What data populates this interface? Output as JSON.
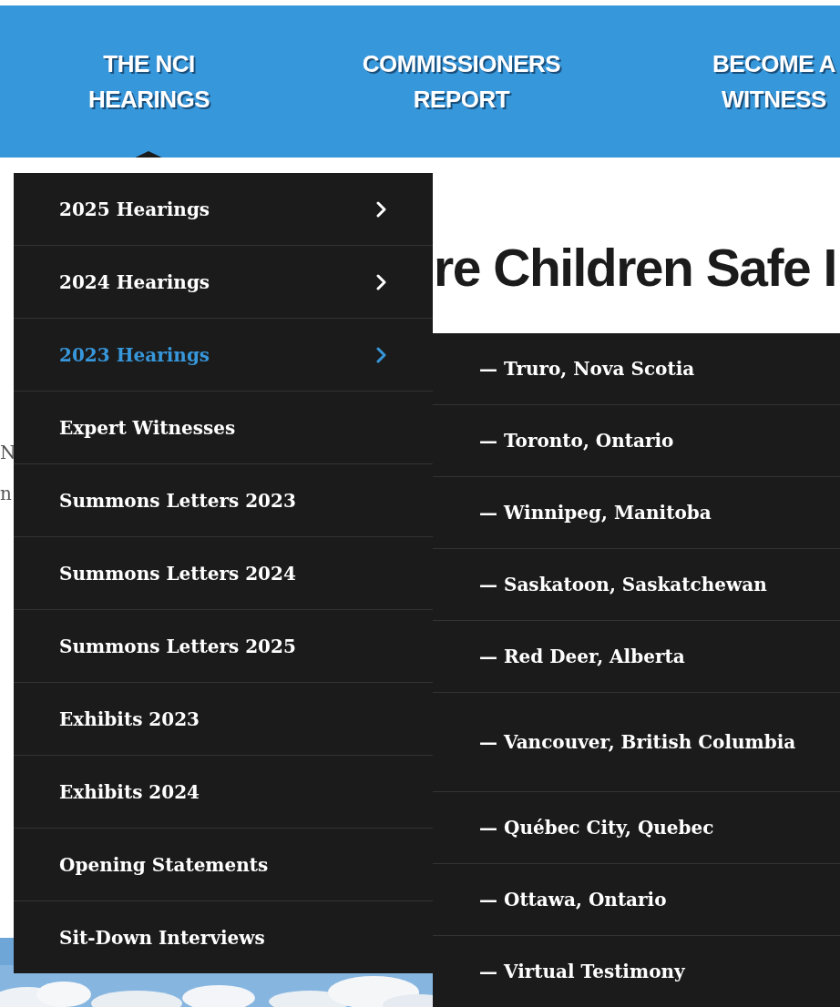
{
  "nav": [
    {
      "lines": [
        "THE NCI",
        "HEARINGS"
      ],
      "selected": true
    },
    {
      "lines": [
        "COMMISSIONERS",
        "REPORT"
      ],
      "selected": false
    },
    {
      "lines": [
        "BECOME A",
        "WITNESS"
      ],
      "selected": false
    }
  ],
  "page": {
    "heading": "re Children Safe I",
    "text_fragments": [
      "N",
      "n"
    ],
    "banner": {
      "kind": "picture"
    }
  },
  "dropdown": {
    "items": [
      {
        "label": "2025 Hearings",
        "has_submenu": true,
        "selected": false
      },
      {
        "label": "2024 Hearings",
        "has_submenu": true,
        "selected": false
      },
      {
        "label": "2023 Hearings",
        "has_submenu": true,
        "selected": true
      },
      {
        "label": "Expert Witnesses",
        "has_submenu": false,
        "selected": false
      },
      {
        "label": "Summons Letters 2023",
        "has_submenu": false,
        "selected": false
      },
      {
        "label": "Summons Letters 2024",
        "has_submenu": false,
        "selected": false
      },
      {
        "label": "Summons Letters 2025",
        "has_submenu": false,
        "selected": false
      },
      {
        "label": "Exhibits 2023",
        "has_submenu": false,
        "selected": false
      },
      {
        "label": "Exhibits 2024",
        "has_submenu": false,
        "selected": false
      },
      {
        "label": "Opening Statements",
        "has_submenu": false,
        "selected": false
      },
      {
        "label": "Sit-Down Interviews",
        "has_submenu": false,
        "selected": false
      }
    ]
  },
  "submenu": {
    "items": [
      "— Truro, Nova Scotia",
      "— Toronto, Ontario",
      "— Winnipeg, Manitoba",
      "— Saskatoon, Saskatchewan",
      "— Red Deer, Alberta",
      "— Vancouver, British Columbia",
      "— Québec City, Quebec",
      "— Ottawa, Ontario",
      "— Virtual Testimony"
    ]
  }
}
